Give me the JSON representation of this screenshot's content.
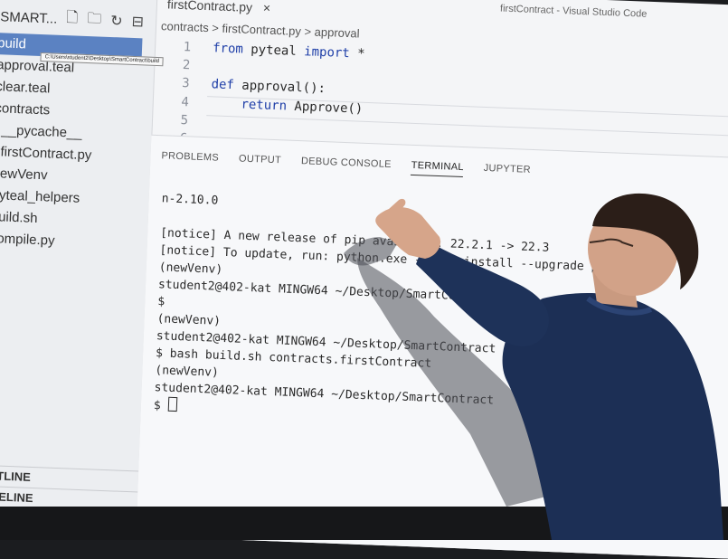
{
  "window_title": "firstContract - Visual Studio Code",
  "explorer": {
    "header": "SMART...",
    "tooltip": "C:\\Users\\student2\\Desktop\\SmartContract\\build",
    "items": [
      {
        "label": "build",
        "selected": true
      },
      {
        "label": "approval.teal"
      },
      {
        "label": "clear.teal"
      },
      {
        "label": "contracts"
      },
      {
        "label": "__pycache__"
      },
      {
        "label": "firstContract.py"
      },
      {
        "label": "newVenv"
      },
      {
        "label": "pyteal_helpers"
      },
      {
        "label": "build.sh"
      },
      {
        "label": "compile.py"
      }
    ],
    "outline_label": "OUTLINE",
    "timeline_label": "TIMELINE"
  },
  "editor": {
    "tab_label": "firstContract.py",
    "tab_close": "×",
    "breadcrumb": "contracts > firstContract.py > approval",
    "lines": [
      {
        "num": "1",
        "kw": "from",
        "text": " pyteal ",
        "kw2": "import",
        "text2": " *"
      },
      {
        "num": "2",
        "kw": "",
        "text": "",
        "kw2": "",
        "text2": ""
      },
      {
        "num": "3",
        "kw": "def",
        "text": " approval():",
        "kw2": "",
        "text2": ""
      },
      {
        "num": "4",
        "kw": "    return",
        "text": " Approve()",
        "kw2": "",
        "text2": ""
      },
      {
        "num": "5",
        "kw": "",
        "text": "",
        "kw2": "",
        "text2": ""
      },
      {
        "num": "6",
        "kw": "",
        "text": "",
        "kw2": "",
        "text2": ""
      }
    ]
  },
  "panel": {
    "tabs": [
      "PROBLEMS",
      "OUTPUT",
      "DEBUG CONSOLE",
      "TERMINAL",
      "JUPYTER"
    ],
    "active_tab": "TERMINAL",
    "terminal_lines": [
      "n-2.10.0",
      "",
      "[notice] A new release of pip available: 22.2.1 -> 22.3",
      "[notice] To update, run: python.exe -m pip install --upgrade pip",
      "(newVenv)",
      "student2@402-kat MINGW64 ~/Desktop/SmartContract",
      "$",
      "(newVenv)",
      "student2@402-kat MINGW64 ~/Desktop/SmartContract",
      "$ bash build.sh contracts.firstContract",
      "(newVenv)",
      "student2@402-kat MINGW64 ~/Desktop/SmartContract",
      "$ "
    ]
  },
  "colors": {
    "keyword": "#1f3fa8",
    "selected_item": "#5b82c2",
    "sweater": "#1c2f55",
    "screen": "#f4f5f7"
  }
}
